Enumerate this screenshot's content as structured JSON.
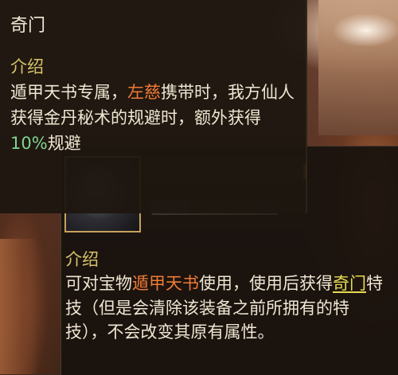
{
  "tooltip_primary": {
    "title": "奇门",
    "section_label": "介绍",
    "description": {
      "part1": "遁甲天书专属，",
      "character": "左慈",
      "part2": "携带时，我方仙人获得金丹秘术的规避时，额外获得",
      "bonus": "10%",
      "part3": "规避"
    }
  },
  "tooltip_item": {
    "section_label": "介绍",
    "description": {
      "part1": "可对宝物",
      "item_link": "遁甲天书",
      "part2": "使用，使用后获得",
      "skill_link": "奇门",
      "part3": "特技（但是会清除该装备之前所拥有的特技），不会改变其原有属性。"
    }
  },
  "colors": {
    "section_label": "#d6c46b",
    "character_highlight": "#f07a36",
    "bonus_highlight": "#7fd48d",
    "link_highlight": "#e8dc55",
    "item_frame": "#c8a25a"
  },
  "icons": {
    "item_icon": "treasure-book-icon"
  }
}
